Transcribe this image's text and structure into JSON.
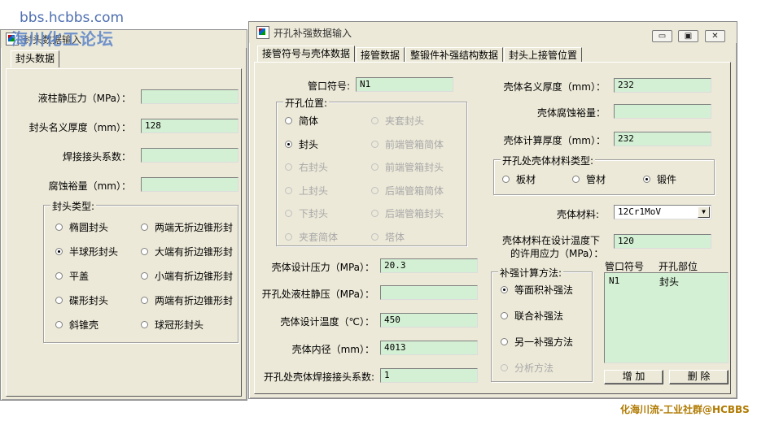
{
  "watermark": {
    "site": "bbs.hcbbs.com",
    "forum": "海川化工论坛",
    "footer": "化海川流-工业社群@HCBBS"
  },
  "back_window": {
    "title": "封头数据输入",
    "tab": "封头数据",
    "fields": [
      {
        "label": "液柱静压力（MPa）：",
        "value": ""
      },
      {
        "label": "封头名义厚度（mm）：",
        "value": "128"
      },
      {
        "label": "焊接接头系数：",
        "value": ""
      },
      {
        "label": "腐蚀裕量（mm）：",
        "value": ""
      }
    ],
    "head_type": {
      "title": "封头类型:",
      "options": [
        {
          "label": "椭圆封头",
          "checked": false
        },
        {
          "label": "两端无折边锥形封",
          "checked": false
        },
        {
          "label": "半球形封头",
          "checked": true
        },
        {
          "label": "大端有折边锥形封",
          "checked": false
        },
        {
          "label": "平盖",
          "checked": false
        },
        {
          "label": "小端有折边锥形封",
          "checked": false
        },
        {
          "label": "碟形封头",
          "checked": false
        },
        {
          "label": "两端有折边锥形封",
          "checked": false
        },
        {
          "label": "斜锥壳",
          "checked": false
        },
        {
          "label": "球冠形封头",
          "checked": false
        }
      ]
    }
  },
  "front_window": {
    "title": "开孔补强数据输入",
    "controls": {
      "minimize": "▭",
      "restore": "▣",
      "close": "✕"
    },
    "tabs": [
      "接管符号与壳体数据",
      "接管数据",
      "整锻件补强结构数据",
      "封头上接管位置"
    ],
    "nozzle_symbol": {
      "label": "管口符号:",
      "value": "N1"
    },
    "opening_position": {
      "title": "开孔位置:",
      "options": [
        {
          "label": "简体",
          "state": "unchecked"
        },
        {
          "label": "夹套封头",
          "state": "disabled"
        },
        {
          "label": "封头",
          "state": "checked"
        },
        {
          "label": "前端管箱简体",
          "state": "disabled"
        },
        {
          "label": "右封头",
          "state": "disabled"
        },
        {
          "label": "前端管箱封头",
          "state": "disabled"
        },
        {
          "label": "上封头",
          "state": "disabled"
        },
        {
          "label": "后端管箱简体",
          "state": "disabled"
        },
        {
          "label": "下封头",
          "state": "disabled"
        },
        {
          "label": "后端管箱封头",
          "state": "disabled"
        },
        {
          "label": "夹套简体",
          "state": "disabled"
        },
        {
          "label": "塔体",
          "state": "disabled"
        }
      ]
    },
    "shell_fields": [
      {
        "label": "壳体设计压力（MPa）：",
        "value": "20.3"
      },
      {
        "label": "开孔处液柱静压（MPa）：",
        "value": ""
      },
      {
        "label": "壳体设计温度（℃）：",
        "value": "450"
      },
      {
        "label": "壳体内径（mm）：",
        "value": "4013"
      },
      {
        "label": "开孔处壳体焊接接头系数:",
        "value": "1"
      }
    ],
    "right_fields": [
      {
        "label": "壳体名义厚度（mm）：",
        "value": "232"
      },
      {
        "label": "壳体腐蚀裕量：",
        "value": ""
      },
      {
        "label": "壳体计算厚度（mm）：",
        "value": "232"
      }
    ],
    "material_type": {
      "title": "开孔处壳体材料类型:",
      "options": [
        {
          "label": "板材",
          "checked": false
        },
        {
          "label": "管材",
          "checked": false
        },
        {
          "label": "锻件",
          "checked": true
        }
      ]
    },
    "shell_material": {
      "label": "壳体材料:",
      "value": "12Cr1MoV"
    },
    "allowable_stress": {
      "label_line1": "壳体材料在设计温度下",
      "label_line2": "的许用应力（MPa）：",
      "value": "120"
    },
    "reinforcement_method": {
      "title": "补强计算方法:",
      "options": [
        {
          "label": "等面积补强法",
          "state": "checked"
        },
        {
          "label": "联合补强法",
          "state": "unchecked"
        },
        {
          "label": "另一补强方法",
          "state": "unchecked"
        },
        {
          "label": "分析方法",
          "state": "disabled"
        }
      ]
    },
    "nozzle_list": {
      "headers": [
        "管口符号",
        "开孔部位"
      ],
      "rows": [
        {
          "symbol": "N1",
          "position": "封头"
        }
      ]
    },
    "buttons": {
      "add": "增 加",
      "delete": "删 除"
    }
  }
}
